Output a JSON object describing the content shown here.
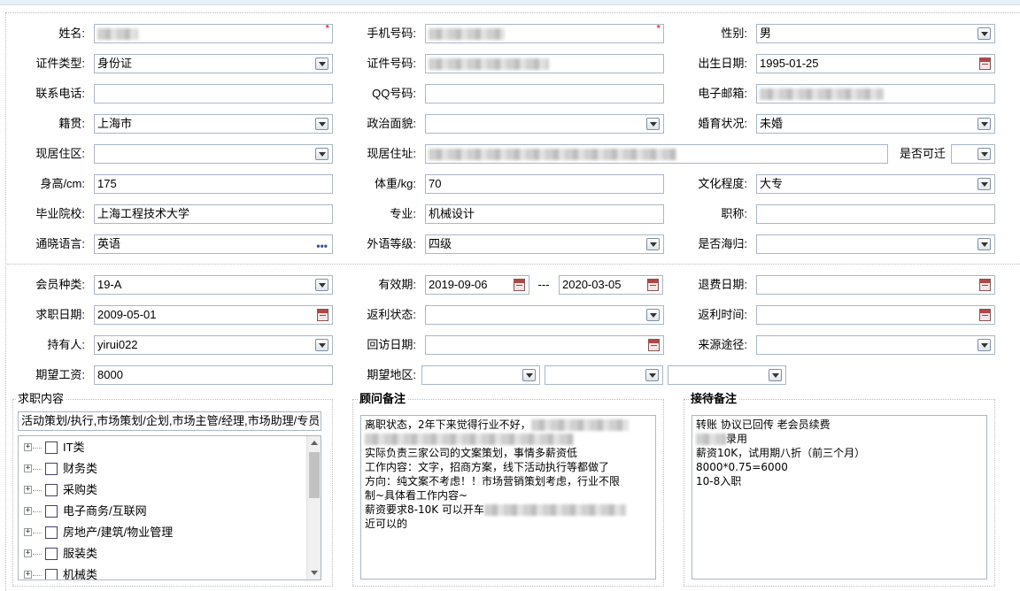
{
  "section1": {
    "name_label": "姓名:",
    "phone_label": "手机号码:",
    "gender_label": "性别:",
    "gender_value": "男",
    "idtype_label": "证件类型:",
    "idtype_value": "身份证",
    "idno_label": "证件号码:",
    "birth_label": "出生日期:",
    "birth_value": "1995-01-25",
    "contact_label": "联系电话:",
    "qq_label": "QQ号码:",
    "email_label": "电子邮箱:",
    "native_label": "籍贯:",
    "native_value": "上海市",
    "political_label": "政治面貌:",
    "marital_label": "婚育状况:",
    "marital_value": "未婚",
    "district_label": "现居住区:",
    "address_label": "现居住址:",
    "relocate_label": "是否可迁",
    "height_label": "身高/cm:",
    "height_value": "175",
    "weight_label": "体重/kg:",
    "weight_value": "70",
    "education_label": "文化程度:",
    "education_value": "大专",
    "school_label": "毕业院校:",
    "school_value": "上海工程技术大学",
    "major_label": "专业:",
    "major_value": "机械设计",
    "title_label": "职称:",
    "language_label": "通晓语言:",
    "language_value": "英语",
    "foreign_level_label": "外语等级:",
    "foreign_level_value": "四级",
    "overseas_label": "是否海归:",
    "required_mark": "*"
  },
  "section2": {
    "member_type_label": "会员种类:",
    "member_type_value": "19-A",
    "validity_label": "有效期:",
    "validity_from": "2019-09-06",
    "validity_sep": "---",
    "validity_to": "2020-03-05",
    "refund_date_label": "退费日期:",
    "job_date_label": "求职日期:",
    "job_date_value": "2009-05-01",
    "rebate_status_label": "返利状态:",
    "rebate_time_label": "返利时间:",
    "holder_label": "持有人:",
    "holder_value": "yirui022",
    "revisit_label": "回访日期:",
    "source_label": "来源途径:",
    "salary_label": "期望工资:",
    "salary_value": "8000",
    "region_label": "期望地区:"
  },
  "job_content": {
    "legend": "求职内容",
    "summary": "活动策划/执行,市场策划/企划,市场主管/经理,市场助理/专员",
    "tree_items": [
      "IT类",
      "财务类",
      "采购类",
      "电子商务/互联网",
      "房地产/建筑/物业管理",
      "服装类",
      "机械类"
    ]
  },
  "consultant_notes": {
    "legend": "顾问备注",
    "lines": [
      "离职状态，2年下来觉得行业不好，",
      "",
      "实际负责三家公司的文案策划，事情多薪资低",
      "工作内容：文字，招商方案，线下活动执行等都做了",
      "方向：纯文案不考虑！！市场营销策划考虑，行业不限",
      "制~具体看工作内容~",
      "薪资要求8-10K 可以开车",
      "近可以的"
    ]
  },
  "reception_notes": {
    "legend": "接待备注",
    "lines": [
      "转账 协议已回传 老会员续费",
      "录用",
      "薪资10K，试用期八折（前三个月）",
      "8000*0.75=6000",
      "10-8入职"
    ]
  }
}
